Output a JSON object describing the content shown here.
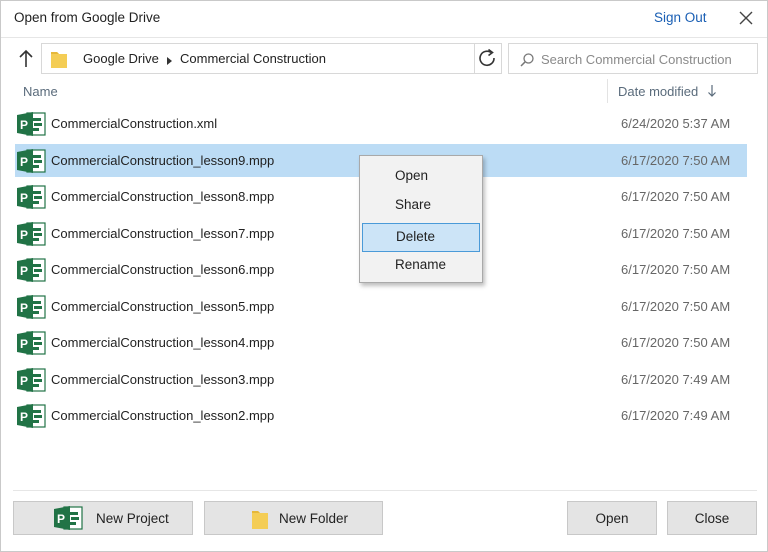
{
  "window": {
    "title": "Open from Google Drive",
    "sign_out": "Sign Out",
    "close_icon": "close-icon"
  },
  "nav": {
    "up_icon": "up-arrow-icon",
    "breadcrumb": [
      "Google Drive",
      "Commercial Construction"
    ],
    "refresh_icon": "refresh-icon",
    "search_placeholder": "Search Commercial Construction"
  },
  "columns": {
    "name": "Name",
    "date_modified": "Date modified",
    "sort": "descending"
  },
  "files": [
    {
      "name": "CommercialConstruction.xml",
      "date": "6/24/2020 5:37 AM",
      "icon": "project-file-icon",
      "selected": false
    },
    {
      "name": "CommercialConstruction_lesson9.mpp",
      "date": "6/17/2020 7:50 AM",
      "icon": "project-file-icon",
      "selected": true
    },
    {
      "name": "CommercialConstruction_lesson8.mpp",
      "date": "6/17/2020 7:50 AM",
      "icon": "project-file-icon",
      "selected": false
    },
    {
      "name": "CommercialConstruction_lesson7.mpp",
      "date": "6/17/2020 7:50 AM",
      "icon": "project-file-icon",
      "selected": false
    },
    {
      "name": "CommercialConstruction_lesson6.mpp",
      "date": "6/17/2020 7:50 AM",
      "icon": "project-file-icon",
      "selected": false
    },
    {
      "name": "CommercialConstruction_lesson5.mpp",
      "date": "6/17/2020 7:50 AM",
      "icon": "project-file-icon",
      "selected": false
    },
    {
      "name": "CommercialConstruction_lesson4.mpp",
      "date": "6/17/2020 7:50 AM",
      "icon": "project-file-icon",
      "selected": false
    },
    {
      "name": "CommercialConstruction_lesson3.mpp",
      "date": "6/17/2020 7:49 AM",
      "icon": "project-file-icon",
      "selected": false
    },
    {
      "name": "CommercialConstruction_lesson2.mpp",
      "date": "6/17/2020 7:49 AM",
      "icon": "project-file-icon",
      "selected": false
    }
  ],
  "context_menu": {
    "items": [
      "Open",
      "Share",
      "Delete",
      "Rename"
    ],
    "highlighted": "Delete"
  },
  "footer": {
    "new_project": "New Project",
    "new_folder": "New Folder",
    "open": "Open",
    "close": "Close"
  },
  "colors": {
    "selection": "#bcdcf5",
    "project_green": "#217346",
    "link_blue": "#1a5fb4",
    "folder_yellow": "#f4cd55"
  }
}
